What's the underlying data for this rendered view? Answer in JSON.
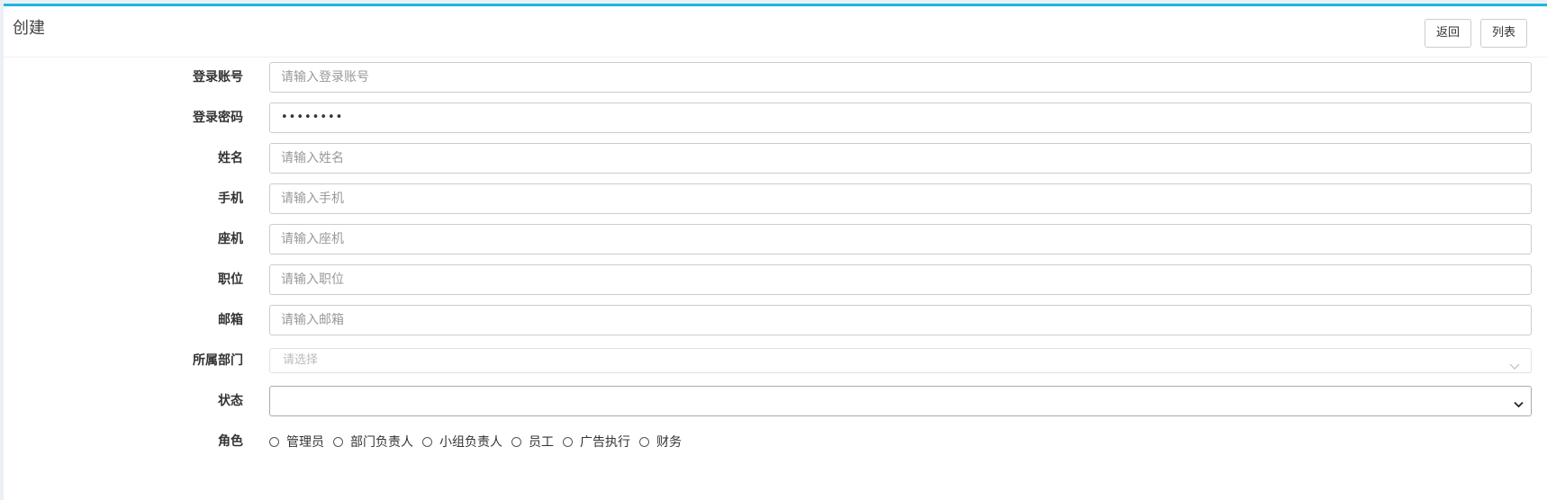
{
  "header": {
    "title": "创建",
    "back_label": "返回",
    "list_label": "列表"
  },
  "form": {
    "login_account": {
      "label": "登录账号",
      "placeholder": "请输入登录账号"
    },
    "login_password": {
      "label": "登录密码",
      "value": "••••••••"
    },
    "name": {
      "label": "姓名",
      "placeholder": "请输入姓名"
    },
    "mobile": {
      "label": "手机",
      "placeholder": "请输入手机"
    },
    "landline": {
      "label": "座机",
      "placeholder": "请输入座机"
    },
    "position": {
      "label": "职位",
      "placeholder": "请输入职位"
    },
    "email": {
      "label": "邮箱",
      "placeholder": "请输入邮箱"
    },
    "department": {
      "label": "所属部门",
      "placeholder": "请选择"
    },
    "status": {
      "label": "状态",
      "value": ""
    },
    "role": {
      "label": "角色",
      "options": [
        "管理员",
        "部门负责人",
        "小组负责人",
        "员工",
        "广告执行",
        "财务"
      ]
    }
  },
  "colors": {
    "accent_top_border": "#1cb5e0",
    "page_background": "#ecf0f5"
  }
}
